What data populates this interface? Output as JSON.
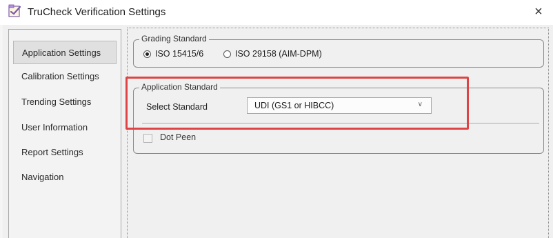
{
  "window": {
    "title": "TruCheck Verification Settings",
    "close_glyph": "×"
  },
  "sidebar": {
    "items": [
      {
        "label": "Application Settings",
        "active": true
      },
      {
        "label": "Calibration Settings",
        "active": false
      },
      {
        "label": "Trending Settings",
        "active": false
      },
      {
        "label": "User Information",
        "active": false
      },
      {
        "label": "Report Settings",
        "active": false
      },
      {
        "label": "Navigation",
        "active": false
      }
    ]
  },
  "grading": {
    "title": "Grading Standard",
    "options": [
      {
        "label": "ISO 15415/6",
        "checked": true
      },
      {
        "label": "ISO 29158 (AIM-DPM)",
        "checked": false
      }
    ]
  },
  "application_standard": {
    "title": "Application Standard",
    "select_label": "Select Standard",
    "selected": "UDI (GS1 or HIBCC)",
    "chevron": "∨"
  },
  "dot_peen": {
    "label": "Dot Peen",
    "checked": false
  },
  "colors": {
    "highlight": "#e04343",
    "panel_bg": "#f0f0f0",
    "active_item_bg": "#e0e0e0"
  },
  "icons": {
    "app": "app-check-icon",
    "close": "close-icon",
    "dropdown": "chevron-down-icon"
  }
}
